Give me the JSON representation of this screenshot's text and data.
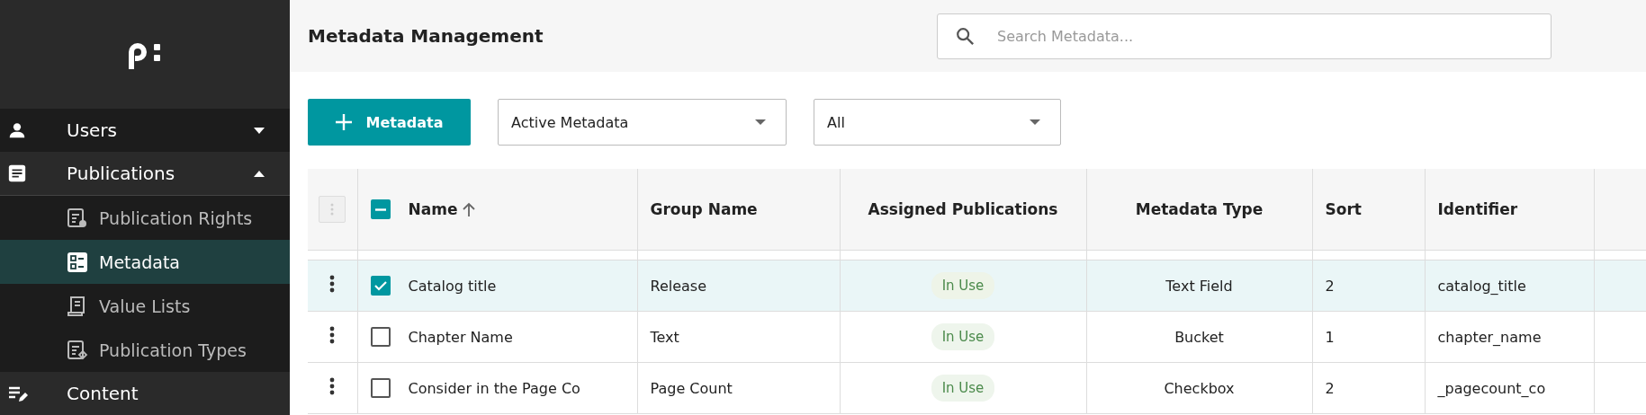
{
  "sidebar": {
    "items": [
      {
        "label": "Users",
        "kind": "group",
        "expanded": false
      },
      {
        "label": "Publications",
        "kind": "group",
        "expanded": true,
        "children": [
          {
            "label": "Publication Rights",
            "selected": false
          },
          {
            "label": "Metadata",
            "selected": true
          },
          {
            "label": "Value Lists",
            "selected": false
          },
          {
            "label": "Publication Types",
            "selected": false
          }
        ]
      },
      {
        "label": "Content",
        "kind": "link"
      }
    ]
  },
  "header": {
    "title": "Metadata Management",
    "search": {
      "placeholder": "Search Metadata..."
    }
  },
  "toolbar": {
    "add_button": "Metadata",
    "filters": [
      {
        "value": "Active Metadata"
      },
      {
        "value": "All"
      }
    ]
  },
  "table": {
    "select_all": {
      "indeterminate": true
    },
    "columns": [
      {
        "label": "Name",
        "sorted": true
      },
      {
        "label": "Group Name",
        "sorted": false
      },
      {
        "label": "Assigned Publications",
        "sorted": false
      },
      {
        "label": "Metadata Type",
        "sorted": false
      },
      {
        "label": "Sort",
        "sorted": false
      },
      {
        "label": "Identifier",
        "sorted": false
      }
    ],
    "rows": [
      {
        "selected": true,
        "cells": [
          "Catalog title",
          "Release",
          "In Use",
          "Text Field",
          "2",
          "catalog_title"
        ]
      },
      {
        "selected": false,
        "cells": [
          "Chapter Name",
          "Text",
          "In Use",
          "Bucket",
          "1",
          "chapter_name"
        ]
      },
      {
        "selected": false,
        "cells": [
          "Consider in the Page Co",
          "Page Count",
          "In Use",
          "Checkbox",
          "2",
          "_pagecount_co"
        ]
      }
    ]
  }
}
